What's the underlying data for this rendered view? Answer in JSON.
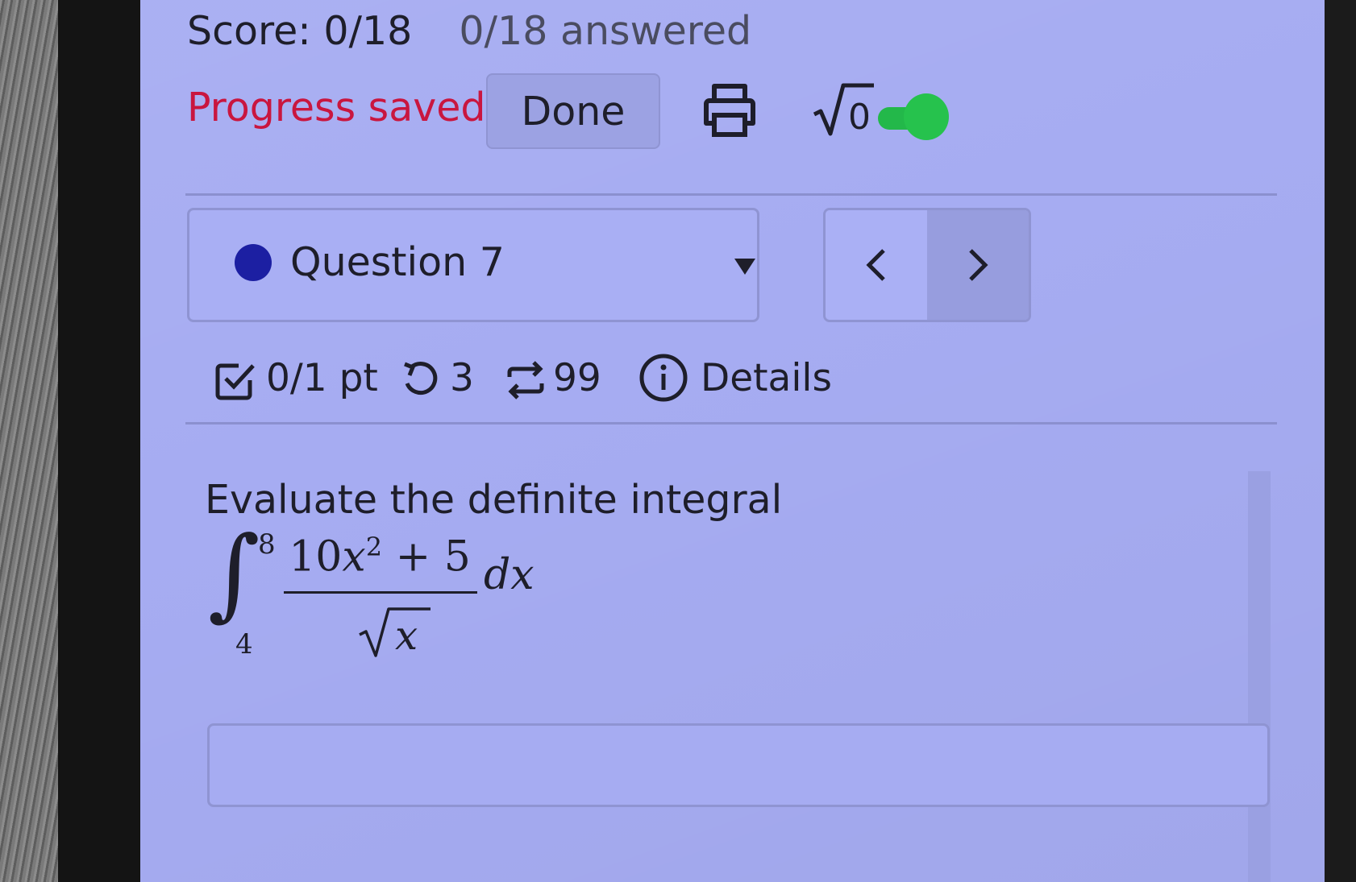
{
  "header": {
    "score": "Score: 0/18",
    "answered": "0/18 answered",
    "progress_status": "Progress saved",
    "done_label": "Done",
    "math_toggle_symbol": "√0"
  },
  "question_nav": {
    "current": "Question 7"
  },
  "question_meta": {
    "points": "0/1 pt",
    "attempts": "3",
    "versions": "99",
    "details_label": "Details"
  },
  "problem": {
    "prompt": "Evaluate the definite integral",
    "upper_limit": "8",
    "lower_limit": "4",
    "numerator_coef": "10",
    "numerator_var": "x",
    "numerator_exp": "2",
    "numerator_rest": " + 5",
    "denominator_var": "x",
    "differential": "dx"
  },
  "answer": {
    "value": ""
  },
  "colors": {
    "screen_bg": "#a6acf2",
    "saved_text": "#c9163f",
    "toggle_on": "#26c24d",
    "question_dot": "#1c1fa2"
  },
  "icons": [
    "print-icon",
    "square-root-icon",
    "toggle-switch",
    "caret-down-icon",
    "chevron-left-icon",
    "chevron-right-icon",
    "checkbox-icon",
    "retry-icon",
    "repeat-icon",
    "info-icon"
  ]
}
